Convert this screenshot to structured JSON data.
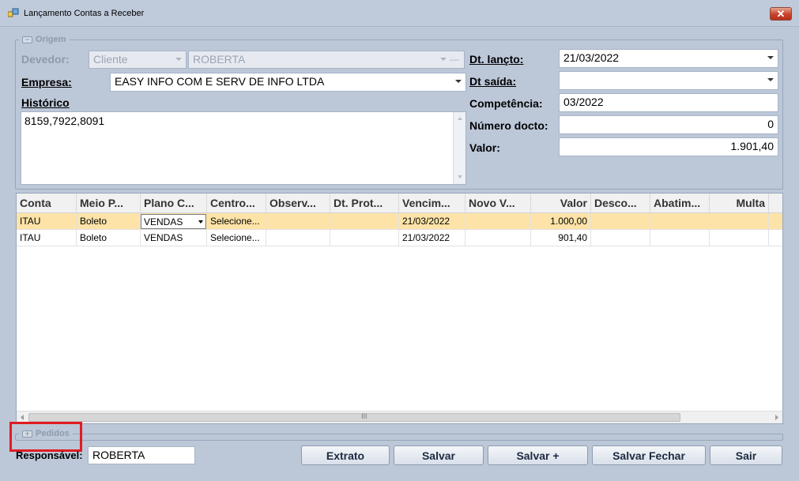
{
  "window": {
    "title": "Lançamento Contas a Receber",
    "close_label": "✕"
  },
  "origem": {
    "legend": "Origem",
    "toggle": "−",
    "devedor_label": "Devedor:",
    "devedor_type": "Cliente",
    "devedor_name": "ROBERTA",
    "empresa_label": "Empresa:",
    "empresa_value": "EASY INFO COM E SERV DE INFO LTDA",
    "historico_label": "Histórico",
    "historico_value": "8159,7922,8091",
    "dt_lancto_label": "Dt. lançto:",
    "dt_lancto_value": "21/03/2022",
    "dt_saida_label": "Dt saída:",
    "dt_saida_value": "",
    "competencia_label": "Competência:",
    "competencia_value": "03/2022",
    "numero_docto_label": "Número docto:",
    "numero_docto_value": "0",
    "valor_label": "Valor:",
    "valor_value": "1.901,40"
  },
  "grid": {
    "columns": [
      "Conta",
      "Meio P...",
      "Plano C...",
      "Centro...",
      "Observ...",
      "Dt. Prot...",
      "Vencim...",
      "Novo V...",
      "Valor",
      "Desco...",
      "Abatim...",
      "Multa"
    ],
    "rows": [
      [
        "ITAU",
        "Boleto",
        "VENDAS",
        "Selecione...",
        "",
        "",
        "21/03/2022",
        "",
        "1.000,00",
        "",
        "",
        ""
      ],
      [
        "ITAU",
        "Boleto",
        "VENDAS",
        "Selecione...",
        "",
        "",
        "21/03/2022",
        "",
        "901,40",
        "",
        "",
        ""
      ]
    ],
    "scroll_grip": "III"
  },
  "pedidos": {
    "legend": "Pedidos",
    "toggle": "+"
  },
  "footer": {
    "responsavel_label": "Responsável:",
    "responsavel_value": "ROBERTA",
    "buttons": {
      "extrato": "Extrato",
      "salvar": "Salvar",
      "salvar_plus": "Salvar +",
      "salvar_fechar": "Salvar Fechar",
      "sair": "Sair"
    }
  },
  "colors": {
    "highlight": "#e11b22",
    "selected_row": "#fde3a8",
    "window_bg": "#bcc7d8"
  }
}
